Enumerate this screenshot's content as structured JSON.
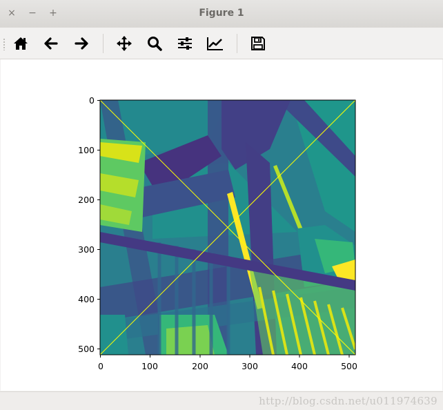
{
  "window": {
    "title": "Figure 1",
    "controls": {
      "close": "×",
      "minimize": "−",
      "maximize": "+"
    }
  },
  "toolbar": {
    "buttons": [
      {
        "name": "home",
        "icon": "home-icon"
      },
      {
        "name": "back",
        "icon": "arrow-left-icon"
      },
      {
        "name": "forward",
        "icon": "arrow-right-icon"
      },
      {
        "name": "pan",
        "icon": "move-icon"
      },
      {
        "name": "zoom",
        "icon": "magnifier-icon"
      },
      {
        "name": "subplots",
        "icon": "sliders-icon"
      },
      {
        "name": "edit-axes",
        "icon": "chart-line-icon"
      },
      {
        "name": "save",
        "icon": "floppy-disk-icon"
      }
    ]
  },
  "plot": {
    "x_ticks": [
      "0",
      "100",
      "200",
      "300",
      "400",
      "500"
    ],
    "y_ticks": [
      "0",
      "100",
      "200",
      "300",
      "400",
      "500"
    ],
    "image_description_colormap": "viridis",
    "line_color": "#ffff00"
  },
  "watermark": "http://blog.csdn.net/u011974639"
}
